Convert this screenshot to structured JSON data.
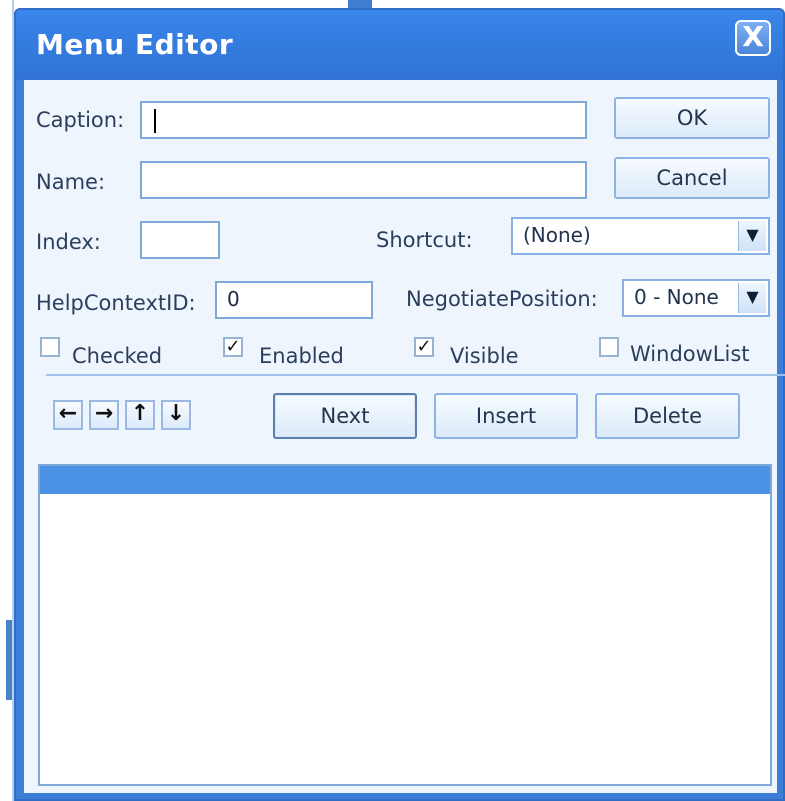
{
  "window": {
    "title": "Menu Editor",
    "close_icon": "close-icon"
  },
  "form": {
    "caption_label": "Caption:",
    "caption_value": "",
    "name_label": "Name:",
    "name_value": "",
    "index_label": "Index:",
    "index_value": "",
    "shortcut_label": "Shortcut:",
    "shortcut_value": "(None)",
    "helpcontext_label": "HelpContextID:",
    "helpcontext_value": "0",
    "negotiate_label": "NegotiatePosition:",
    "negotiate_value": "0 - None"
  },
  "buttons": {
    "ok": "OK",
    "cancel": "Cancel",
    "next": "Next",
    "insert": "Insert",
    "delete": "Delete"
  },
  "checkboxes": {
    "checked": {
      "label": "Checked",
      "state": false
    },
    "enabled": {
      "label": "Enabled",
      "state": true
    },
    "visible": {
      "label": "Visible",
      "state": true
    },
    "windowlist": {
      "label": "WindowList",
      "state": false
    }
  },
  "arrows": {
    "left": "←",
    "right": "→",
    "up": "↑",
    "down": "↓"
  },
  "symbols": {
    "dropdown": "▼",
    "check": "✓",
    "close": "X"
  },
  "menu_list": {
    "items": []
  },
  "colors": {
    "title_bar": "#2f72d4",
    "dialog_background": "#eef5fc",
    "selection": "#4d93e5"
  }
}
